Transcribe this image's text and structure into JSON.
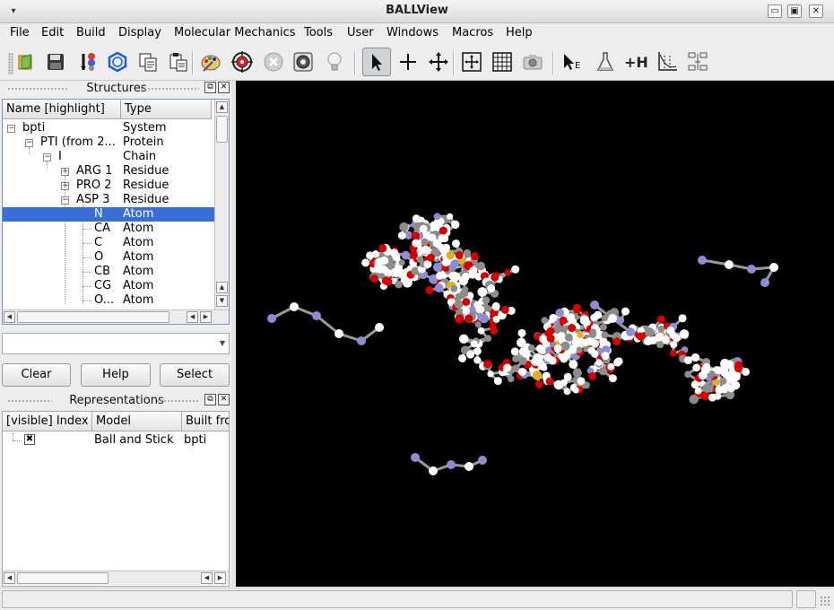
{
  "window": {
    "title": "BALLView",
    "menu_glyph": "▾",
    "btn_min": "▭",
    "btn_max": "▣",
    "btn_close": "✕"
  },
  "menubar": [
    "File",
    "Edit",
    "Build",
    "Display",
    "Molecular Mechanics",
    "Tools",
    "User",
    "Windows",
    "Macros",
    "Help"
  ],
  "toolbar": {
    "items": [
      "open-icon",
      "save-icon",
      "molecule-icon",
      "ring-icon",
      "copy-icon",
      "paste-icon",
      "palette-icon",
      "target-icon",
      "stop-icon",
      "camera-lens-icon",
      "lightbulb-icon",
      "pointer-icon",
      "crosshair-icon",
      "move-icon",
      "fit-icon",
      "grid-icon",
      "camera-icon",
      "select-element-icon",
      "flask-icon",
      "add-hydrogens-icon",
      "plot-icon",
      "measure-icon"
    ],
    "add_h_label": "+H",
    "select_label": "E"
  },
  "structures": {
    "title": "Structures",
    "float_glyph": "⧉",
    "close_glyph": "✕",
    "headers": [
      "Name [highlight]",
      "Type"
    ],
    "rows": [
      {
        "name": "bpti",
        "type": "System",
        "expander": "−"
      },
      {
        "name": "PTI (from 2...",
        "type": "Protein",
        "expander": "−"
      },
      {
        "name": "I",
        "type": "Chain",
        "expander": "−"
      },
      {
        "name": "ARG 1",
        "type": "Residue",
        "expander": "+"
      },
      {
        "name": "PRO 2",
        "type": "Residue",
        "expander": "+"
      },
      {
        "name": "ASP 3",
        "type": "Residue",
        "expander": "−"
      },
      {
        "name": "N",
        "type": "Atom",
        "expander": ""
      },
      {
        "name": "CA",
        "type": "Atom",
        "expander": ""
      },
      {
        "name": "C",
        "type": "Atom",
        "expander": ""
      },
      {
        "name": "O",
        "type": "Atom",
        "expander": ""
      },
      {
        "name": "CB",
        "type": "Atom",
        "expander": ""
      },
      {
        "name": "CG",
        "type": "Atom",
        "expander": ""
      },
      {
        "name": "O...",
        "type": "Atom",
        "expander": ""
      }
    ],
    "selected_row": "N",
    "query": "",
    "buttons": {
      "clear": "Clear",
      "help": "Help",
      "select": "Select"
    }
  },
  "representations": {
    "title": "Representations",
    "float_glyph": "⧉",
    "close_glyph": "✕",
    "headers": [
      "[visible] Index",
      "Model",
      "Built fro"
    ],
    "rows": [
      {
        "visible_mark": "✖",
        "model": "Ball and Stick",
        "built_from": "bpti"
      }
    ]
  },
  "scroll_glyphs": {
    "up": "▲",
    "down": "▼",
    "left": "◀",
    "right": "▶",
    "dropdown": "▼"
  },
  "colors": {
    "background": "#000000",
    "carbon": "#8c8c8c",
    "hydrogen": "#ffffff",
    "oxygen": "#d40000",
    "nitrogen": "#8c8cd8",
    "sulfur": "#e0b020",
    "selection": "#3a6ed7"
  }
}
